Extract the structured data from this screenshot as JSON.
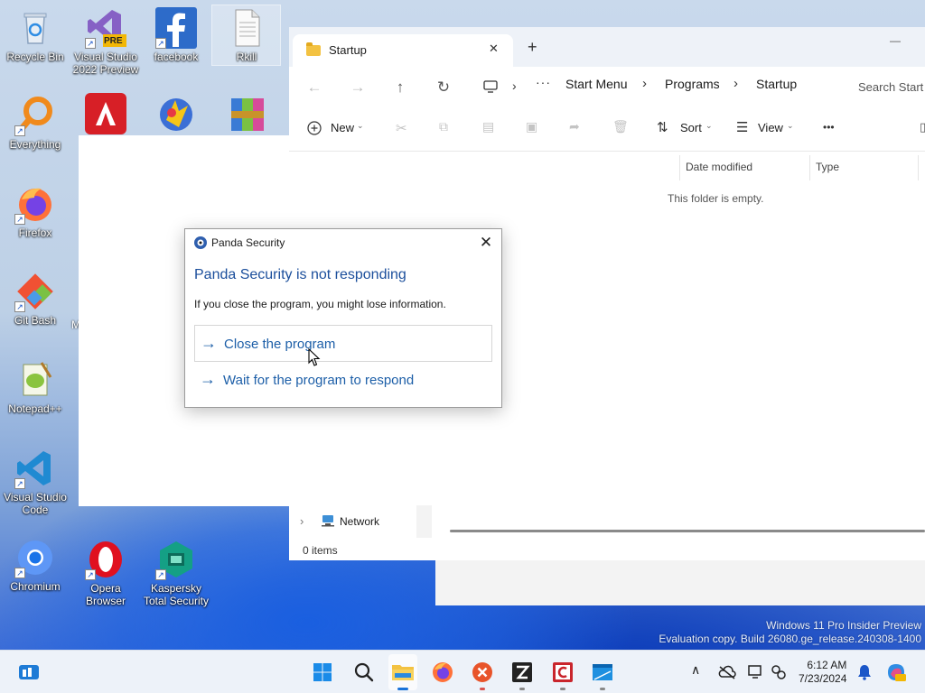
{
  "desktop": {
    "icons": [
      {
        "label": "Recycle Bin",
        "icon": "recycle-bin-icon"
      },
      {
        "label": "Visual Studio 2022 Preview",
        "line1": "Visual Studio",
        "line2": "2022 Preview",
        "badge": "PRE",
        "icon": "visual-studio-icon"
      },
      {
        "label": "facebook",
        "icon": "facebook-icon"
      },
      {
        "label": "Rkill",
        "icon": "document-icon"
      },
      {
        "label": "Everything",
        "icon": "everything-search-icon"
      },
      {
        "label": "Firefox",
        "icon": "firefox-icon"
      },
      {
        "label": "Git Bash",
        "icon": "git-bash-icon"
      },
      {
        "label": "Notepad++",
        "icon": "notepad-plus-plus-icon"
      },
      {
        "label": "Visual Studio Code",
        "line1": "Visual Studio",
        "line2": "Code",
        "icon": "vscode-icon"
      },
      {
        "label": "Chromium",
        "icon": "chromium-icon"
      },
      {
        "label": "Opera Browser",
        "line1": "Opera",
        "line2": "Browser",
        "icon": "opera-icon"
      },
      {
        "label": "Kaspersky Total Security",
        "line1": "Kaspersky",
        "line2": "Total Security",
        "icon": "kaspersky-icon"
      }
    ],
    "partial_letter": "M"
  },
  "explorer": {
    "tab_title": "Startup",
    "tab_close": "✕",
    "new_tab": "+",
    "minimize": "—",
    "breadcrumb": [
      "Start Menu",
      "Programs",
      "Startup"
    ],
    "search_placeholder": "Search Start",
    "toolbar": {
      "new": "New",
      "sort": "Sort",
      "view": "View",
      "more": "•••"
    },
    "columns": [
      "Date modified",
      "Type"
    ],
    "empty_message": "This folder is empty.",
    "sidebar_network": "Network",
    "status": "0 items"
  },
  "dialog": {
    "title": "Panda Security",
    "close": "✕",
    "heading": "Panda Security is not responding",
    "message": "If you close the program, you might lose information.",
    "option_close": "Close the program",
    "option_wait": "Wait for the program to respond",
    "arrow": "→"
  },
  "watermark": {
    "line1": "Windows 11 Pro Insider Preview",
    "line2": "Evaluation copy. Build 26080.ge_release.240308-1400"
  },
  "taskbar": {
    "time": "6:12 AM",
    "date": "7/23/2024",
    "apps": [
      "start-icon",
      "search-icon",
      "file-explorer-icon",
      "firefox-icon",
      "x-app-icon",
      "z-app-icon",
      "c-app-icon",
      "window-app-icon"
    ]
  }
}
